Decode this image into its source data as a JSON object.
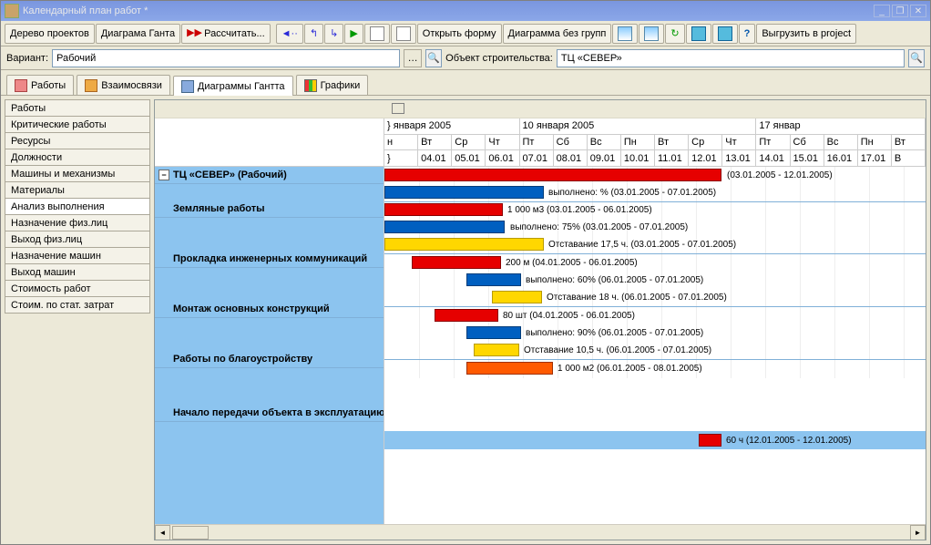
{
  "window": {
    "title": "Календарный план работ *"
  },
  "toolbar": {
    "tree": "Дерево проектов",
    "gantt": "Диаграма Ганта",
    "calc": "Рассчитать...",
    "open_form": "Открыть форму",
    "nogroup": "Диаграмма без групп",
    "export": "Выгрузить в project"
  },
  "filter": {
    "variant_label": "Вариант:",
    "variant_value": "Рабочий",
    "object_label": "Объект строительства:",
    "object_value": "ТЦ «СЕВЕР»"
  },
  "tabs": {
    "works": "Работы",
    "relations": "Взаимосвязи",
    "gantt": "Диаграммы Гантта",
    "charts": "Графики"
  },
  "sidebar": {
    "items": [
      "Работы",
      "Критические работы",
      "Ресурсы",
      "Должности",
      "Машины и механизмы",
      "Материалы",
      "Анализ выполнения",
      "Назначение физ.лиц",
      "Выход физ.лиц",
      "Назначение машин",
      "Выход машин",
      "Стоимость работ",
      "Стоим. по стат. затрат"
    ],
    "active_index": 6
  },
  "timeline": {
    "weeks": [
      "} января 2005",
      "10 января 2005",
      "17 январ"
    ],
    "days_short": [
      "н",
      "Вт",
      "Ср",
      "Чт",
      "Пт",
      "Сб",
      "Вс",
      "Пн",
      "Вт",
      "Ср",
      "Чт",
      "Пт",
      "Сб",
      "Вс",
      "Пн",
      "Вт"
    ],
    "dates": [
      "}",
      "04.01",
      "05.01",
      "06.01",
      "07.01",
      "08.01",
      "09.01",
      "10.01",
      "11.01",
      "12.01",
      "13.01",
      "14.01",
      "15.01",
      "16.01",
      "17.01",
      "В"
    ]
  },
  "tasks": {
    "root": "ТЦ «СЕВЕР» (Рабочий)",
    "t1": "Земляные работы",
    "t2": "Прокладка инженерных коммуникаций",
    "t3": "Монтаж основных конструкций",
    "t4": "Работы по благоустройству",
    "t5": "Начало передачи объекта в эксплуатацию"
  },
  "bars": {
    "root_dates": "(03.01.2005 - 12.01.2005)",
    "root_done": "выполнено: % (03.01.2005 - 07.01.2005)",
    "t1_plan": "1 000 м3 (03.01.2005 - 06.01.2005)",
    "t1_done": "выполнено: 75% (03.01.2005 - 07.01.2005)",
    "t1_lag": "Отставание 17,5 ч. (03.01.2005 - 07.01.2005)",
    "t2_plan": "200 м (04.01.2005 - 06.01.2005)",
    "t2_done": "выполнено: 60% (06.01.2005 - 07.01.2005)",
    "t2_lag": "Отставание 18 ч. (06.01.2005 - 07.01.2005)",
    "t3_plan": "80 шт (04.01.2005 - 06.01.2005)",
    "t3_done": "выполнено: 90% (06.01.2005 - 07.01.2005)",
    "t3_lag": "Отставание 10,5 ч. (06.01.2005 - 07.01.2005)",
    "t4_plan": "1 000 м2 (06.01.2005 - 08.01.2005)",
    "t5_plan": "60 ч (12.01.2005 - 12.01.2005)"
  },
  "chart_data": {
    "type": "gantt",
    "x_start": "03.01.2005",
    "x_end": "17.01.2005",
    "tasks": [
      {
        "name": "ТЦ «СЕВЕР» (Рабочий)",
        "rows": [
          {
            "kind": "plan",
            "start": "03.01.2005",
            "end": "12.01.2005",
            "color": "red"
          },
          {
            "kind": "done",
            "start": "03.01.2005",
            "end": "07.01.2005",
            "color": "blue",
            "label": "выполнено: %"
          }
        ]
      },
      {
        "name": "Земляные работы",
        "rows": [
          {
            "kind": "plan",
            "start": "03.01.2005",
            "end": "06.01.2005",
            "color": "red",
            "label": "1 000 м3"
          },
          {
            "kind": "done",
            "start": "03.01.2005",
            "end": "07.01.2005",
            "color": "blue",
            "label": "выполнено: 75%"
          },
          {
            "kind": "lag",
            "start": "03.01.2005",
            "end": "07.01.2005",
            "color": "yellow",
            "label": "Отставание 17,5 ч."
          }
        ]
      },
      {
        "name": "Прокладка инженерных коммуникаций",
        "rows": [
          {
            "kind": "plan",
            "start": "04.01.2005",
            "end": "06.01.2005",
            "color": "red",
            "label": "200 м"
          },
          {
            "kind": "done",
            "start": "06.01.2005",
            "end": "07.01.2005",
            "color": "blue",
            "label": "выполнено: 60%"
          },
          {
            "kind": "lag",
            "start": "06.01.2005",
            "end": "07.01.2005",
            "color": "yellow",
            "label": "Отставание 18 ч."
          }
        ]
      },
      {
        "name": "Монтаж основных конструкций",
        "rows": [
          {
            "kind": "plan",
            "start": "04.01.2005",
            "end": "06.01.2005",
            "color": "red",
            "label": "80 шт"
          },
          {
            "kind": "done",
            "start": "06.01.2005",
            "end": "07.01.2005",
            "color": "blue",
            "label": "выполнено: 90%"
          },
          {
            "kind": "lag",
            "start": "06.01.2005",
            "end": "07.01.2005",
            "color": "yellow",
            "label": "Отставание 10,5 ч."
          }
        ]
      },
      {
        "name": "Работы по благоустройству",
        "rows": [
          {
            "kind": "plan",
            "start": "06.01.2005",
            "end": "08.01.2005",
            "color": "orange",
            "label": "1 000 м2"
          }
        ]
      },
      {
        "name": "Начало передачи объекта в эксплуатацию",
        "rows": [
          {
            "kind": "plan",
            "start": "12.01.2005",
            "end": "12.01.2005",
            "color": "red",
            "label": "60 ч"
          }
        ]
      }
    ]
  }
}
